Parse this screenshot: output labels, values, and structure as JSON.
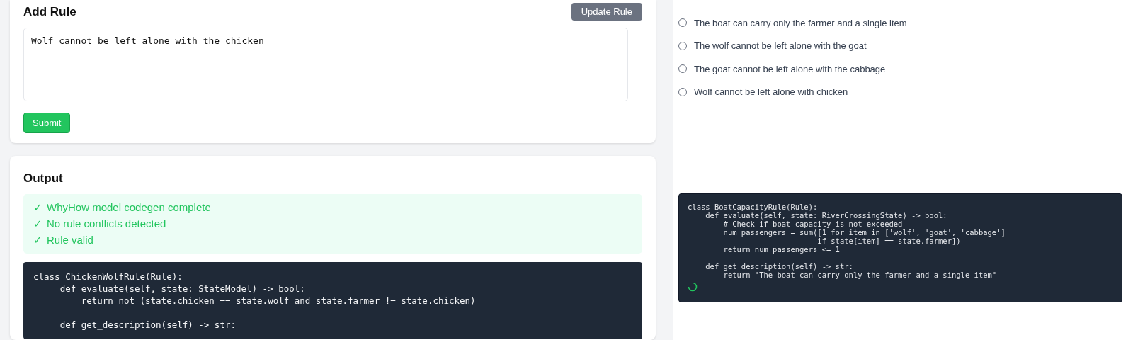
{
  "add_rule": {
    "title": "Add Rule",
    "update_button": "Update Rule",
    "rule_input": {
      "value": "Wolf cannot be left alone with the chicken"
    },
    "submit_button": "Submit"
  },
  "output": {
    "title": "Output",
    "messages": [
      {
        "check": "✓",
        "text": "WhyHow model codegen complete"
      },
      {
        "check": "✓",
        "text": "No rule conflicts detected"
      },
      {
        "check": "✓",
        "text": "Rule valid"
      }
    ],
    "code": "class ChickenWolfRule(Rule):\n     def evaluate(self, state: StateModel) -> bool:\n         return not (state.chicken == state.wolf and state.farmer != state.chicken)\n\n     def get_description(self) -> str:"
  },
  "rules": [
    {
      "label": "The boat can carry only the farmer and a single item",
      "selected": false
    },
    {
      "label": "The wolf cannot be left alone with the goat",
      "selected": false
    },
    {
      "label": "The goat cannot be left alone with the cabbage",
      "selected": false
    },
    {
      "label": "Wolf cannot be left alone with chicken",
      "selected": false
    }
  ],
  "generated_code": {
    "code": "class BoatCapacityRule(Rule):\n    def evaluate(self, state: RiverCrossingState) -> bool:\n        # Check if boat capacity is not exceeded\n        num_passengers = sum([1 for item in ['wolf', 'goat', 'cabbage']\n                             if state[item] == state.farmer])\n        return num_passengers <= 1\n\n    def get_description(self) -> str:\n        return \"The boat can carry only the farmer and a single item\"",
    "loading": true
  }
}
